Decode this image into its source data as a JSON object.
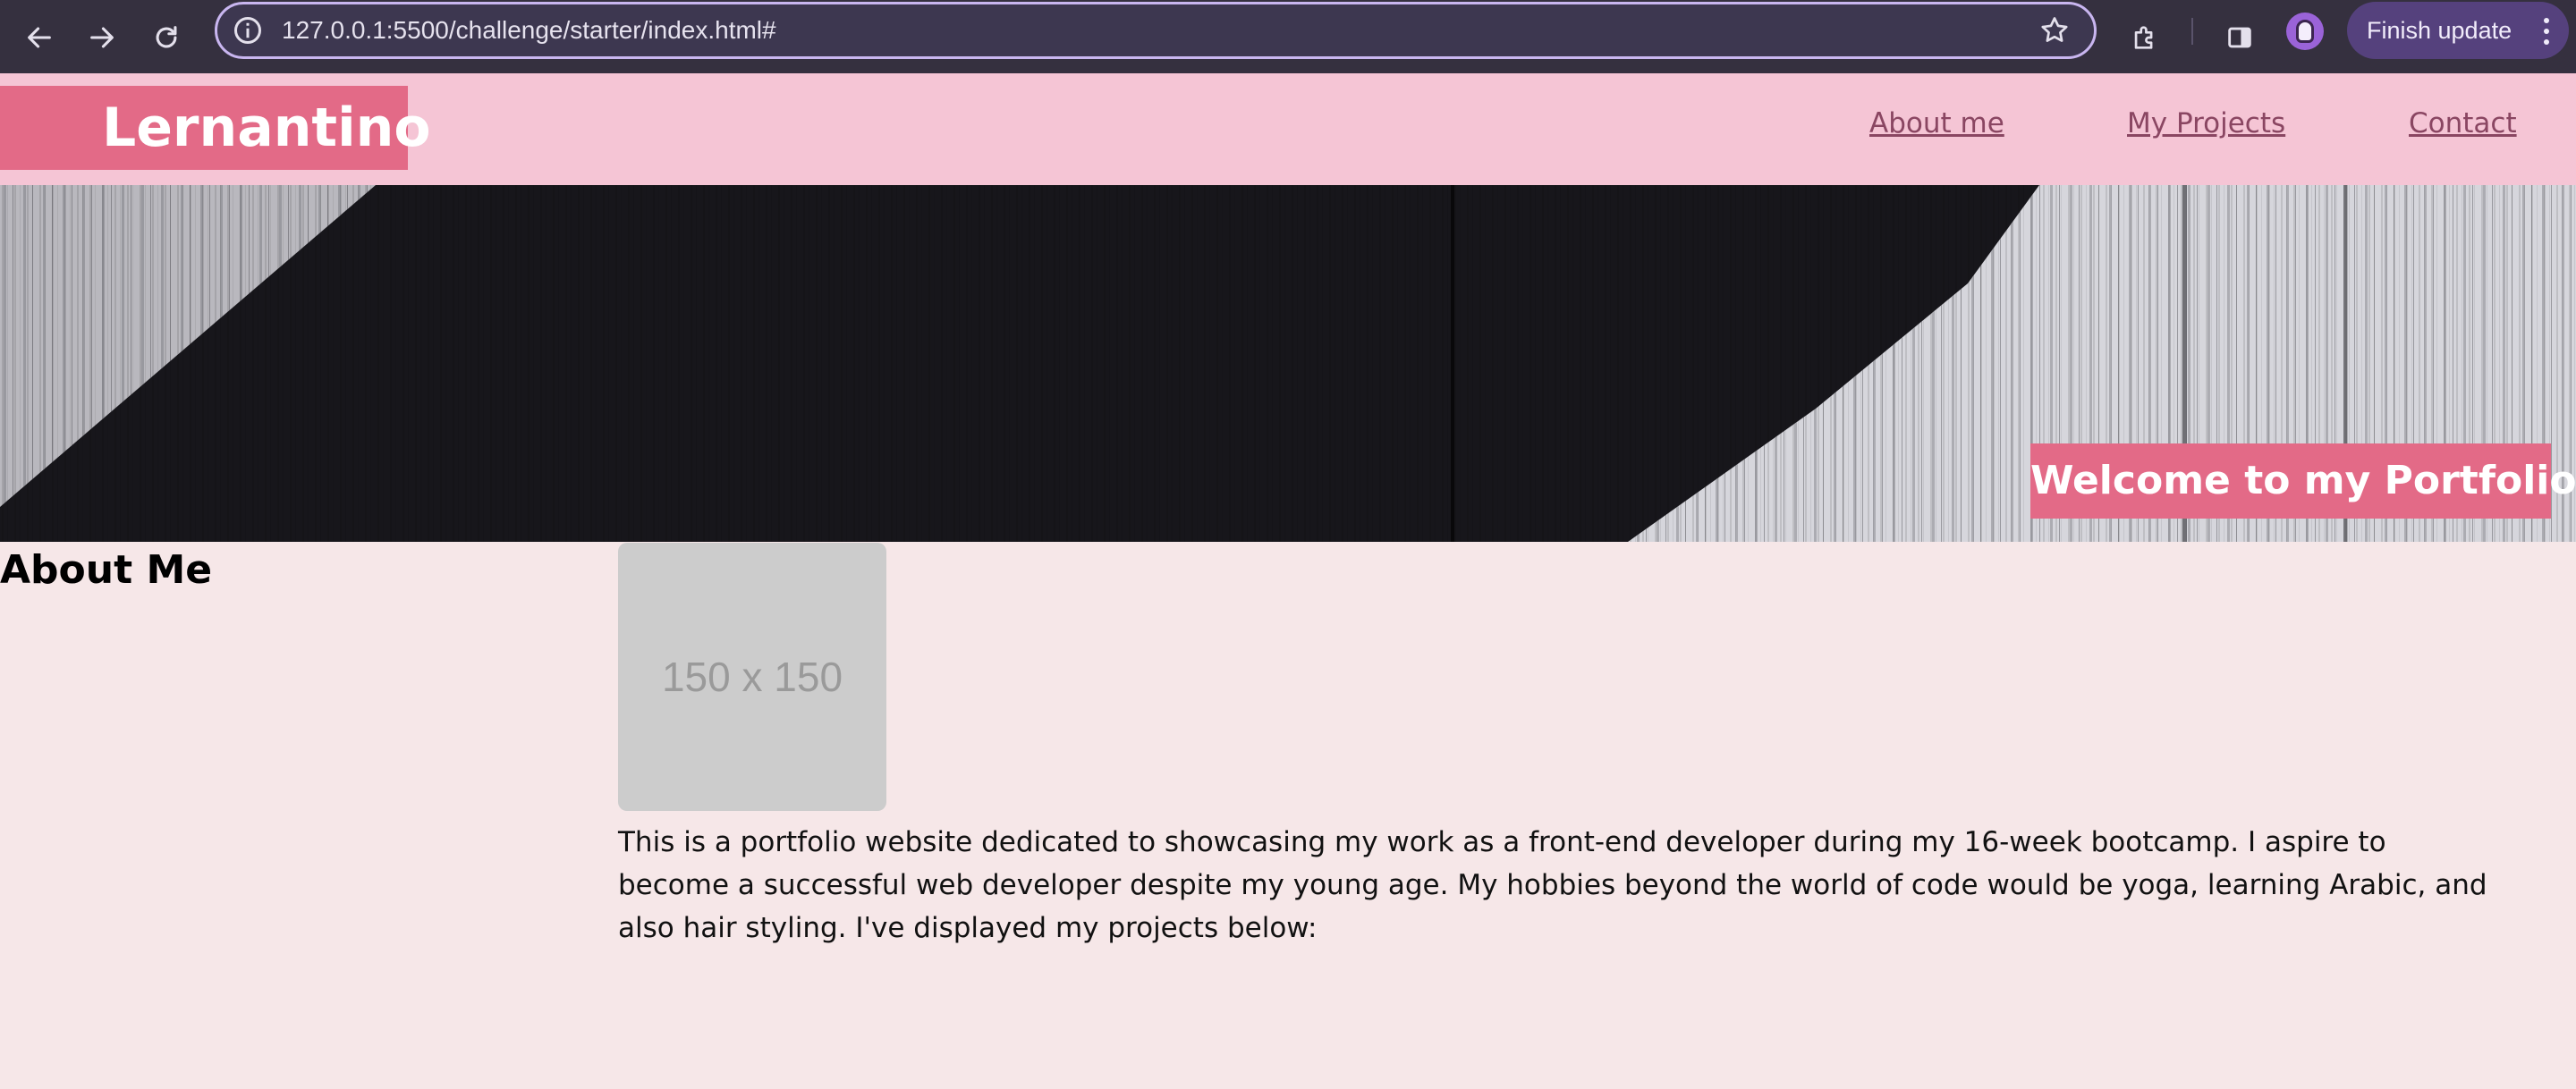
{
  "browser": {
    "url": "127.0.0.1:5500/challenge/starter/index.html#",
    "update_button": "Finish update",
    "icons": {
      "back": "arrow-left-icon",
      "forward": "arrow-right-icon",
      "reload": "reload-icon",
      "site_info": "info-icon",
      "bookmark": "star-icon",
      "extensions": "puzzle-icon",
      "side_panel": "side-panel-icon",
      "profile": "profile-avatar",
      "menu": "kebab-menu-icon"
    },
    "colors": {
      "toolbar": "#35303f",
      "omnibox_border": "#c9b6f0",
      "update_pill": "#55417d"
    }
  },
  "header": {
    "logo": "Lernantino",
    "nav": [
      {
        "label": "About me"
      },
      {
        "label": "My Projects"
      },
      {
        "label": "Contact"
      }
    ],
    "colors": {
      "background": "#f5c5d5",
      "logo_background": "#e36a87",
      "link": "#8a4662"
    }
  },
  "hero": {
    "title": "Welcome to my Portfolio!",
    "title_background": "#e36a87"
  },
  "about": {
    "heading": "About Me",
    "image_placeholder": "150 x 150",
    "text": "This is a portfolio website dedicated to showcasing my work as a front-end developer during my 16-week bootcamp. I aspire to become a successful web developer despite my young age. My hobbies beyond the world of code would be yoga, learning Arabic, and also hair styling. I've displayed my projects below:"
  },
  "page": {
    "background": "#f6e7e8"
  }
}
